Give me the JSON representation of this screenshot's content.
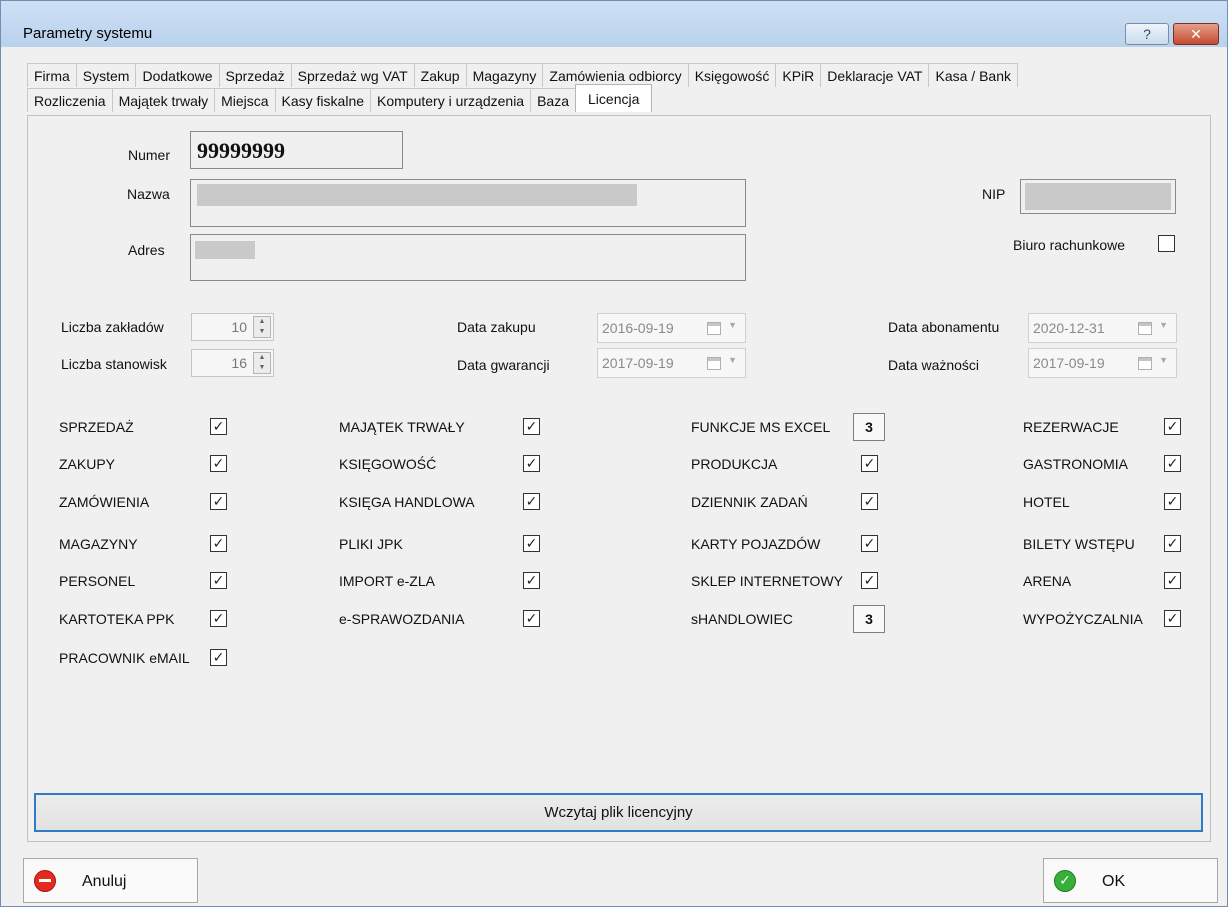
{
  "window": {
    "title": "Parametry systemu",
    "help_glyph": "?",
    "close_glyph": "✕"
  },
  "tabs_row1": [
    "Firma",
    "System",
    "Dodatkowe",
    "Sprzedaż",
    "Sprzedaż wg VAT",
    "Zakup",
    "Magazyny",
    "Zamówienia odbiorcy",
    "Księgowość",
    "KPiR",
    "Deklaracje VAT",
    "Kasa / Bank"
  ],
  "tabs_row2": [
    "Rozliczenia",
    "Majątek trwały",
    "Miejsca",
    "Kasy fiskalne",
    "Komputery i urządzenia",
    "Baza",
    "Licencja"
  ],
  "active_tab": "Licencja",
  "license": {
    "numer_label": "Numer",
    "numer_value": "99999999",
    "nazwa_label": "Nazwa",
    "adres_label": "Adres",
    "nip_label": "NIP",
    "biuro_label": "Biuro rachunkowe",
    "biuro_checked": false,
    "liczba_zakladow_label": "Liczba zakładów",
    "liczba_zakladow_value": "10",
    "liczba_stanowisk_label": "Liczba stanowisk",
    "liczba_stanowisk_value": "16",
    "data_zakupu_label": "Data zakupu",
    "data_zakupu_value": "2016-09-19",
    "data_gwarancji_label": "Data gwarancji",
    "data_gwarancji_value": "2017-09-19",
    "data_abonamentu_label": "Data abonamentu",
    "data_abonamentu_value": "2020-12-31",
    "data_waznosci_label": "Data ważności",
    "data_waznosci_value": "2017-09-19"
  },
  "modules": {
    "col1": [
      {
        "label": "SPRZEDAŻ",
        "checked": true
      },
      {
        "label": "ZAKUPY",
        "checked": true
      },
      {
        "label": "ZAMÓWIENIA",
        "checked": true
      },
      {
        "label": "MAGAZYNY",
        "checked": true
      },
      {
        "label": "PERSONEL",
        "checked": true
      },
      {
        "label": "KARTOTEKA PPK",
        "checked": true
      },
      {
        "label": "PRACOWNIK eMAIL",
        "checked": true
      }
    ],
    "col2": [
      {
        "label": "MAJĄTEK TRWAŁY",
        "checked": true
      },
      {
        "label": "KSIĘGOWOŚĆ",
        "checked": true
      },
      {
        "label": "KSIĘGA HANDLOWA",
        "checked": true
      },
      {
        "label": "PLIKI JPK",
        "checked": true
      },
      {
        "label": "IMPORT e-ZLA",
        "checked": true
      },
      {
        "label": "e-SPRAWOZDANIA",
        "checked": true
      }
    ],
    "col3": [
      {
        "label": "FUNKCJE MS EXCEL",
        "count": "3"
      },
      {
        "label": "PRODUKCJA",
        "checked": true
      },
      {
        "label": "DZIENNIK ZADAŃ",
        "checked": true
      },
      {
        "label": "KARTY POJAZDÓW",
        "checked": true
      },
      {
        "label": "SKLEP INTERNETOWY",
        "checked": true
      },
      {
        "label": "sHANDLOWIEC",
        "count": "3"
      }
    ],
    "col4": [
      {
        "label": "REZERWACJE",
        "checked": true
      },
      {
        "label": "GASTRONOMIA",
        "checked": true
      },
      {
        "label": "HOTEL",
        "checked": true
      },
      {
        "label": "BILETY WSTĘPU",
        "checked": true
      },
      {
        "label": "ARENA",
        "checked": true
      },
      {
        "label": "WYPOŻYCZALNIA",
        "checked": true
      }
    ]
  },
  "buttons": {
    "load_license": "Wczytaj plik licencyjny",
    "cancel": "Anuluj",
    "ok": "OK"
  },
  "check_glyph": "✓"
}
